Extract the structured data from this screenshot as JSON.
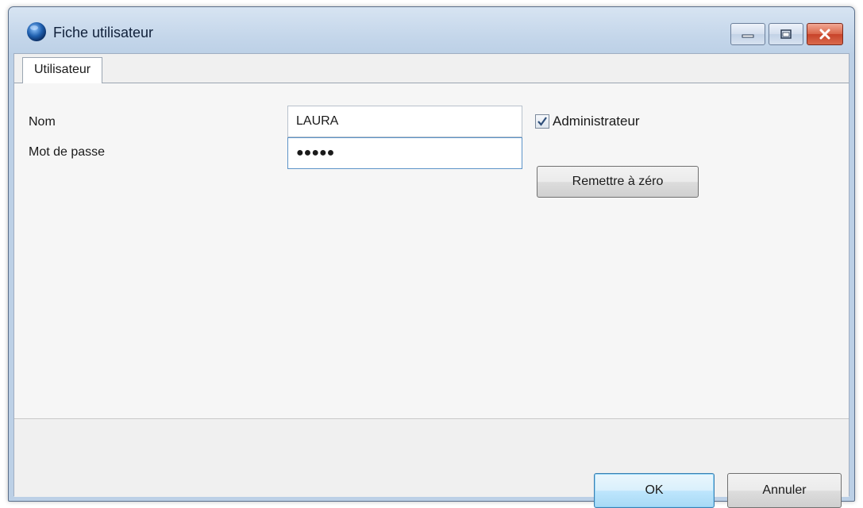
{
  "window": {
    "title": "Fiche utilisateur",
    "app_icon": "globe-icon",
    "controls": {
      "minimize_icon": "minimize-icon",
      "maximize_icon": "maximize-icon",
      "close_icon": "close-icon"
    }
  },
  "tabs": [
    {
      "label": "Utilisateur",
      "selected": true
    }
  ],
  "form": {
    "name_label": "Nom",
    "name_value": "LAURA",
    "password_label": "Mot de passe",
    "password_value": "●●●●●",
    "admin_label": "Administrateur",
    "admin_checked": true,
    "reset_label": "Remettre à zéro"
  },
  "footer": {
    "ok_label": "OK",
    "cancel_label": "Annuler"
  },
  "colors": {
    "titlebar": "#c4d6ea",
    "close_button": "#c8432a",
    "default_button_border": "#3c7fb1"
  }
}
